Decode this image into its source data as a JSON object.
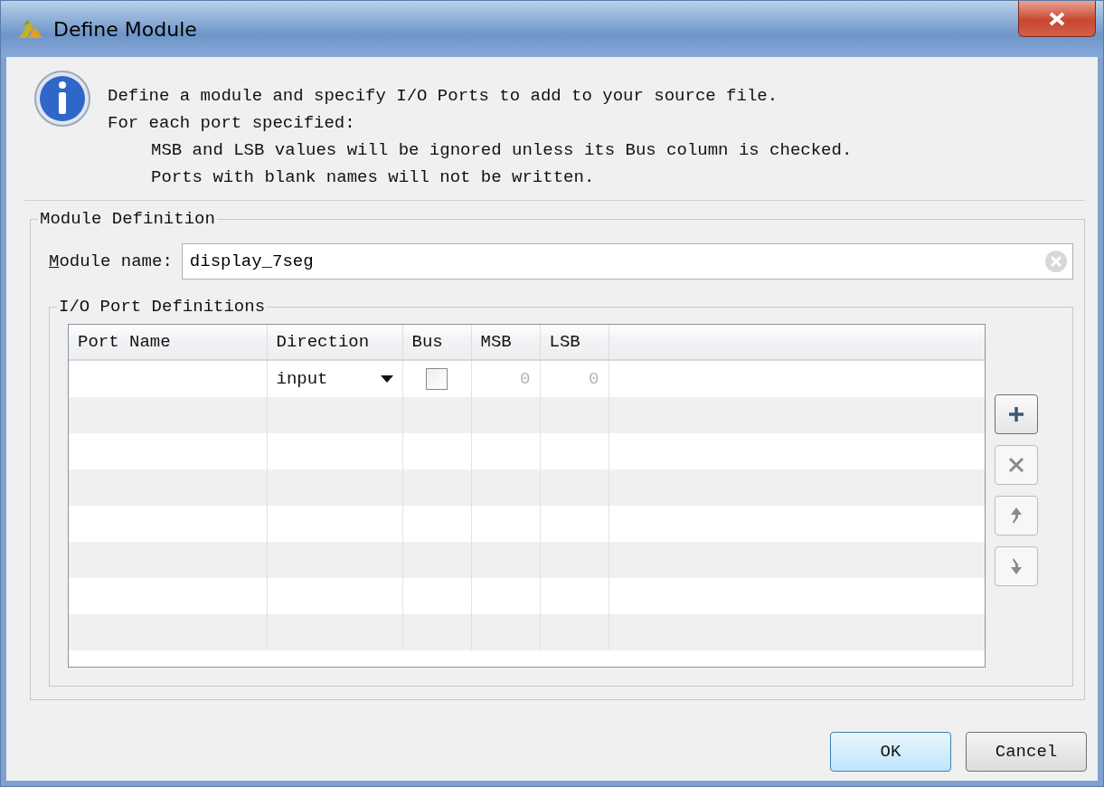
{
  "window": {
    "title": "Define Module"
  },
  "info": {
    "lines": [
      {
        "text": "Define a module and specify I/O Ports to add to your source file.",
        "indent": false
      },
      {
        "text": "For each port specified:",
        "indent": false
      },
      {
        "text": "MSB and LSB values will be ignored unless its Bus column is checked.",
        "indent": true
      },
      {
        "text": "Ports with blank names will not be written.",
        "indent": true
      }
    ]
  },
  "module_definition": {
    "title": "Module Definition",
    "name_label": "Module name:",
    "name_value": "display_7seg",
    "ports": {
      "title": "I/O Port Definitions",
      "columns": [
        "Port Name",
        "Direction",
        "Bus",
        "MSB",
        "LSB"
      ],
      "rows": [
        {
          "port_name": "",
          "direction": "input",
          "bus": false,
          "msb": "0",
          "lsb": "0"
        }
      ],
      "buttons": [
        {
          "kind": "add",
          "disabled": false
        },
        {
          "kind": "remove",
          "disabled": true
        },
        {
          "kind": "up",
          "disabled": true
        },
        {
          "kind": "down",
          "disabled": true
        }
      ]
    }
  },
  "buttons": [
    {
      "label": "OK",
      "default": true
    },
    {
      "label": "Cancel",
      "default": false
    }
  ]
}
